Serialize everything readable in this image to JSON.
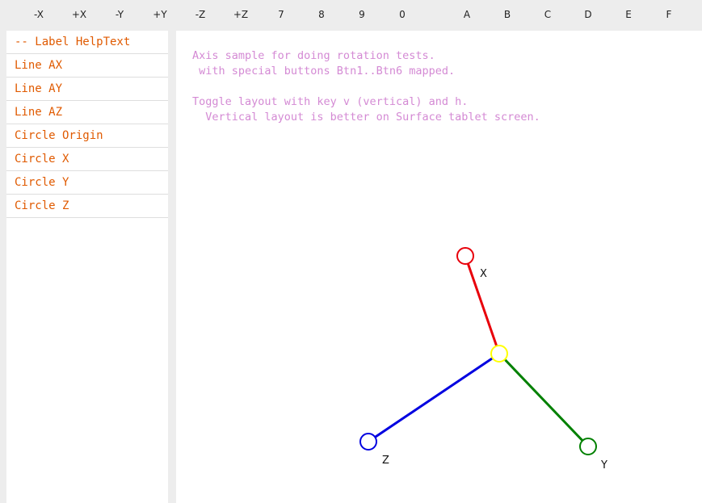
{
  "toolbar": {
    "buttons": [
      "-X",
      "+X",
      "-Y",
      "+Y",
      "-Z",
      "+Z",
      "7",
      "8",
      "9",
      "0",
      "A",
      "B",
      "C",
      "D",
      "E",
      "F"
    ]
  },
  "sidebar": {
    "items": [
      {
        "label": "-- Label HelpText"
      },
      {
        "label": "Line AX"
      },
      {
        "label": "Line AY"
      },
      {
        "label": "Line AZ"
      },
      {
        "label": "Circle Origin"
      },
      {
        "label": "Circle X"
      },
      {
        "label": "Circle Y"
      },
      {
        "label": "Circle Z"
      }
    ]
  },
  "help_text": {
    "lines": [
      "Axis sample for doing rotation tests.",
      " with special buttons Btn1..Btn6 mapped.",
      "",
      "Toggle layout with key v (vertical) and h.",
      "  Vertical layout is better on Surface tablet screen."
    ]
  },
  "axis_labels": {
    "x": "X",
    "y": "Y",
    "z": "Z"
  },
  "colors": {
    "x_axis": "#e8000b",
    "y_axis": "#008000",
    "z_axis": "#0000e0",
    "origin": "#ffff00",
    "menu_text": "#e05a00",
    "help_text": "#d48ad4"
  }
}
